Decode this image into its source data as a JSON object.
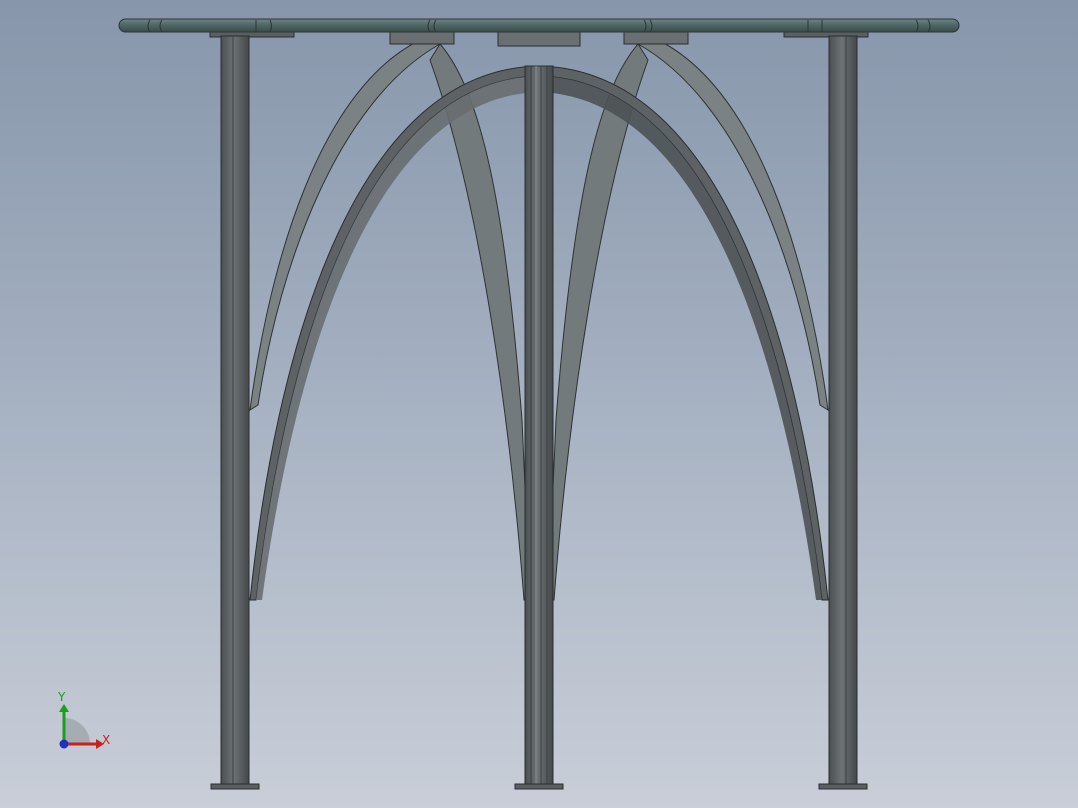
{
  "view": {
    "background_top": "#8796ab",
    "background_bottom": "#c9ced8",
    "model_color": "#5c6264",
    "tabletop_color": "#4e6464"
  },
  "triad": {
    "x_label": "X",
    "y_label": "Y",
    "x_color": "#cc2020",
    "y_color": "#18a018",
    "z_color": "#2030c0"
  }
}
